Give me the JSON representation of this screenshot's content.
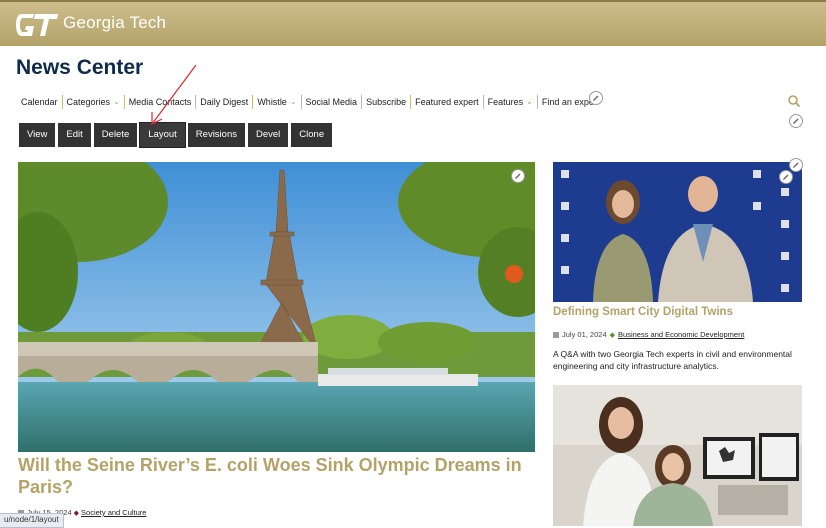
{
  "header": {
    "logo_alt": "GT logo",
    "logo_text": "Georgia Tech",
    "brand_color": "#b3a369",
    "title_color": "#0f2a4a"
  },
  "site_title": "News Center",
  "nav": {
    "items": [
      {
        "label": "Calendar",
        "has_dropdown": false
      },
      {
        "label": "Categories",
        "has_dropdown": true
      },
      {
        "label": "Media Contacts",
        "has_dropdown": false
      },
      {
        "label": "Daily Digest",
        "has_dropdown": false
      },
      {
        "label": "Whistle",
        "has_dropdown": true
      },
      {
        "label": "Social Media",
        "has_dropdown": false
      },
      {
        "label": "Subscribe",
        "has_dropdown": false
      },
      {
        "label": "Featured expert",
        "has_dropdown": false
      },
      {
        "label": "Features",
        "has_dropdown": true
      },
      {
        "label": "Find an expe",
        "has_dropdown": false
      }
    ],
    "search_icon": "search-icon"
  },
  "admin_tabs": [
    "View",
    "Edit",
    "Delete",
    "Layout",
    "Revisions",
    "Devel",
    "Clone"
  ],
  "active_tab": "Layout",
  "main_story": {
    "title": "Will the Seine River’s E. coli Woes Sink Olympic Dreams in Paris?",
    "date": "July 15, 2024",
    "category": "Society and Culture"
  },
  "side_story": {
    "title": "Defining Smart City Digital Twins",
    "date": "July 01, 2024",
    "category": "Business and Economic Development",
    "summary": "A Q&A with two Georgia Tech experts in civil and environmental engineering and city infrastructure analytics."
  },
  "status_url": "u/node/1/layout"
}
